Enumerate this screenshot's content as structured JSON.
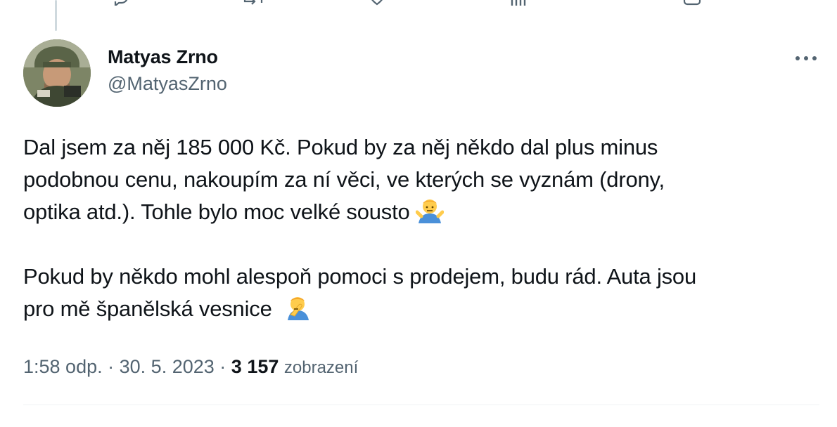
{
  "tweet": {
    "author": {
      "name": "Matyas Zrno",
      "handle": "@MatyasZrno"
    },
    "text": {
      "line1": "Dal jsem za něj 185 000 Kč. Pokud by za něj někdo dal plus minus",
      "line2": "podobnou cenu, nakoupím za ní věci, ve kterých se vyznám (drony,",
      "line3": "optika atd.). Tohle bylo moc velké sousto",
      "line4": "Pokud by někdo mohl alespoň pomoci s prodejem, budu rád. Auta jsou",
      "line5": "pro mě španělská vesnice"
    },
    "emoji": {
      "shrug": "person-shrugging-emoji",
      "facepalm": "person-facepalming-emoji"
    },
    "time": "1:58 odp.",
    "separator": "·",
    "date": "30. 5. 2023",
    "views_count": "3 157",
    "views_label": "zobrazení"
  },
  "icons": [
    "reply-icon",
    "retweet-icon",
    "like-icon",
    "views-icon",
    "bookmark-icon",
    "more-icon"
  ],
  "colors": {
    "text": "#0f1419",
    "secondary": "#536471",
    "divider": "#eff3f4",
    "thread_line": "#cfd9de"
  }
}
